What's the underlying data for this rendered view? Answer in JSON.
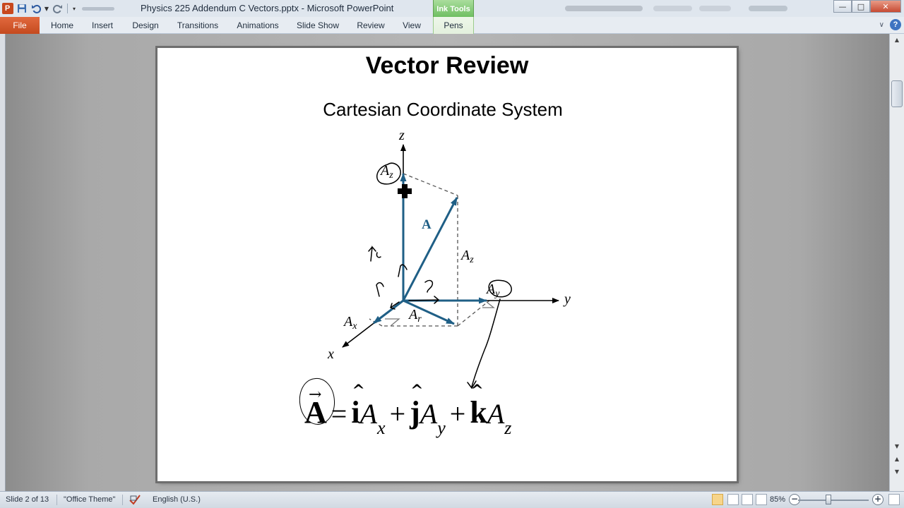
{
  "window": {
    "title": "Physics 225 Addendum C Vectors.pptx - Microsoft PowerPoint",
    "app_logo_letter": "P",
    "contextual_group": "Ink Tools",
    "controls": {
      "minimize": "—",
      "maximize": "□",
      "close": "✕"
    }
  },
  "ribbon": {
    "tabs": [
      "File",
      "Home",
      "Insert",
      "Design",
      "Transitions",
      "Animations",
      "Slide Show",
      "Review",
      "View",
      "Pens"
    ],
    "active_tab": "Pens",
    "help": "?",
    "collapse": "∨"
  },
  "slide": {
    "title": "Vector Review",
    "subtitle": "Cartesian Coordinate System",
    "diagram_labels": {
      "z_axis": "z",
      "y_axis": "y",
      "x_axis": "x",
      "vector": "A",
      "Az_top": "A",
      "Az_top_sub": "z",
      "Az_side": "A",
      "Az_side_sub": "z",
      "Ay": "A",
      "Ay_sub": "y",
      "Ax": "A",
      "Ax_sub": "x",
      "Ar": "A",
      "Ar_sub": "r"
    },
    "equation": {
      "lhs": "A",
      "vec_arrow": "→",
      "equals": "=",
      "plus": "+",
      "hat": "^",
      "terms": [
        {
          "unit": "i",
          "comp": "A",
          "sub": "x"
        },
        {
          "unit": "j",
          "comp": "A",
          "sub": "y"
        },
        {
          "unit": "k",
          "comp": "A",
          "sub": "z"
        }
      ]
    }
  },
  "colors": {
    "vector_blue": "#1f5f86",
    "file_tab": "#d3552a",
    "ink_tools": "#7cc46c"
  },
  "status": {
    "slide_info": "Slide 2 of 13",
    "theme": "\"Office Theme\"",
    "language": "English (U.S.)",
    "zoom": "85%",
    "zoom_level": 0.43
  }
}
